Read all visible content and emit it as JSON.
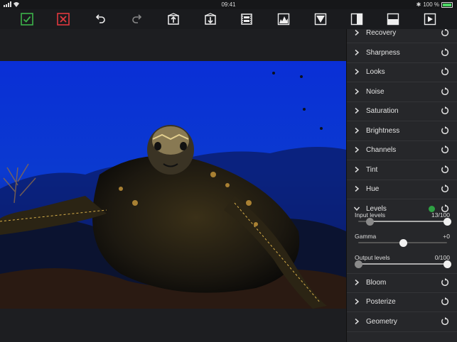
{
  "status": {
    "time": "09:41",
    "battery": "100 %"
  },
  "colors": {
    "accept": "#3cb34a",
    "cancel": "#e0393e",
    "dot": "#2ea043"
  },
  "toolbar": [
    {
      "name": "accept-button",
      "icon": "check-icon"
    },
    {
      "name": "cancel-button",
      "icon": "x-icon"
    },
    {
      "name": "undo-button",
      "icon": "undo-icon"
    },
    {
      "name": "redo-button",
      "icon": "redo-icon"
    },
    {
      "name": "export-button",
      "icon": "box-up-icon"
    },
    {
      "name": "import-button",
      "icon": "box-down-icon"
    },
    {
      "name": "film-button",
      "icon": "film-icon"
    },
    {
      "name": "histogram-button",
      "icon": "histogram-icon"
    },
    {
      "name": "crop-button",
      "icon": "crop-icon"
    },
    {
      "name": "split-vertical-button",
      "icon": "split-v-icon"
    },
    {
      "name": "split-horizontal-button",
      "icon": "split-h-icon"
    },
    {
      "name": "play-button",
      "icon": "play-icon"
    }
  ],
  "panel": {
    "items_before": [
      "Recovery",
      "Sharpness",
      "Looks",
      "Noise",
      "Saturation",
      "Brightness",
      "Channels",
      "Tint",
      "Hue"
    ],
    "levels": {
      "label": "Levels",
      "input_levels": {
        "label": "Input levels",
        "value": "13/100",
        "low": 13,
        "high": 100
      },
      "gamma": {
        "label": "Gamma",
        "value": "+0",
        "level": 0.5
      },
      "output_levels": {
        "label": "Output levels",
        "value": "0/100",
        "low": 0,
        "high": 100
      }
    },
    "items_after": [
      "Bloom",
      "Posterize",
      "Geometry"
    ]
  }
}
